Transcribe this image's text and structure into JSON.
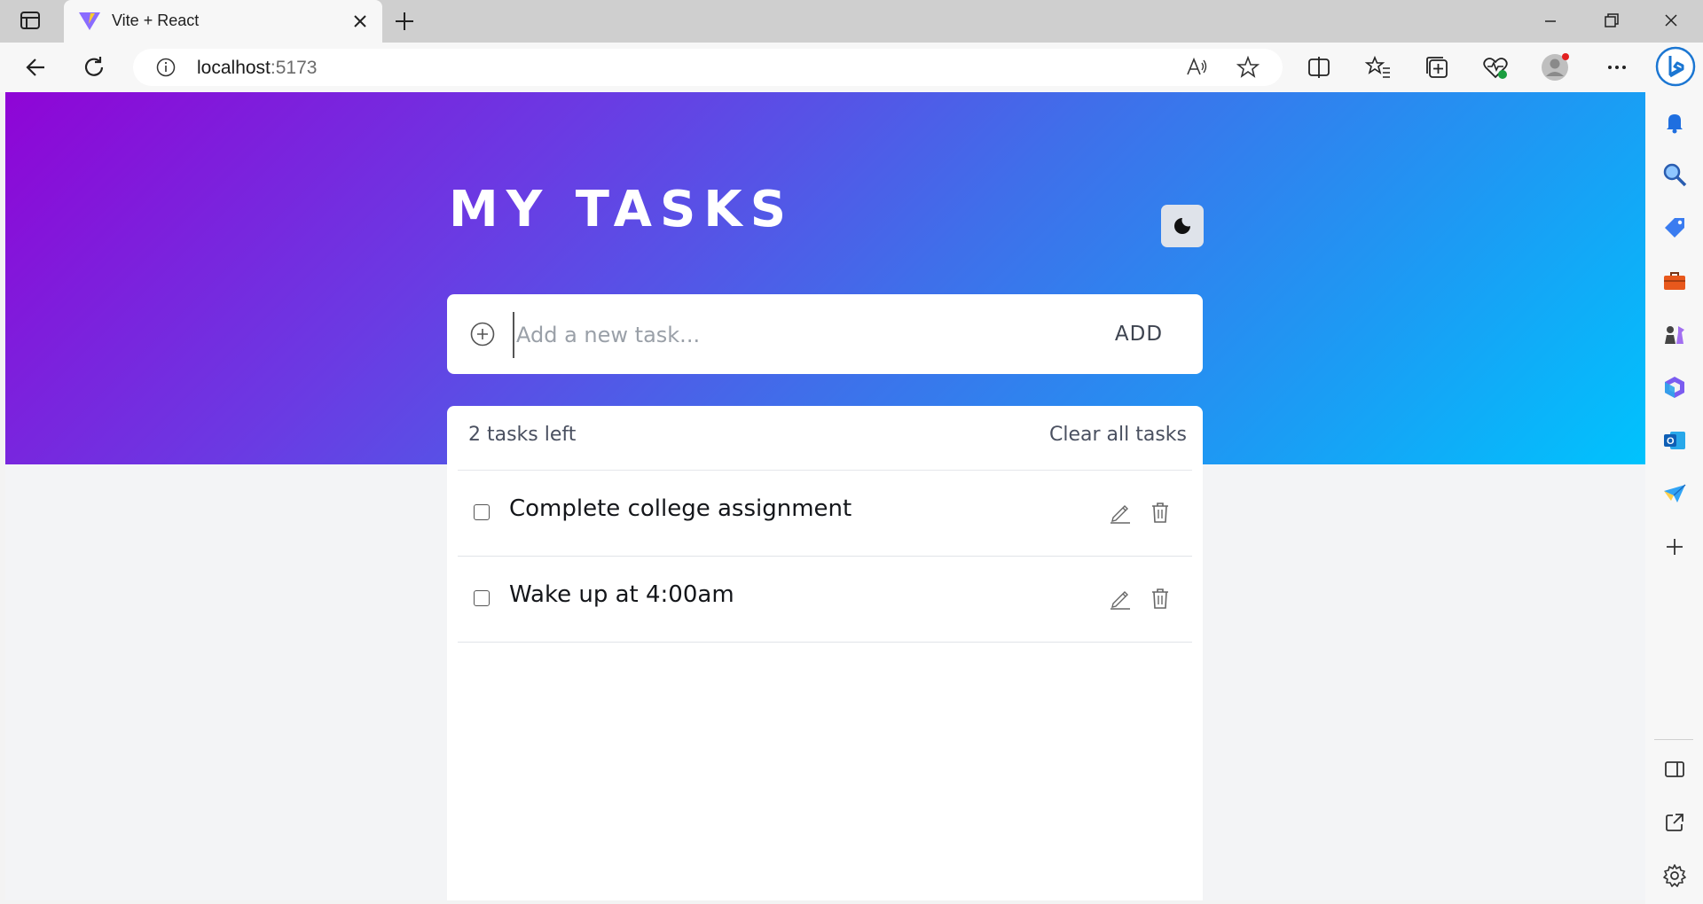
{
  "browser": {
    "tab_title": "Vite + React",
    "address_host": "localhost",
    "address_port": ":5173"
  },
  "app": {
    "title": "MY TASKS",
    "input_placeholder": "Add a new task...",
    "add_label": "ADD",
    "tasks_left": "2 tasks left",
    "clear_label": "Clear all tasks",
    "tasks": [
      {
        "text": "Complete college assignment",
        "done": false
      },
      {
        "text": "Wake up at 4:00am",
        "done": false
      }
    ]
  },
  "colors": {
    "gradient_start": "#8f05d6",
    "gradient_end": "#00c3fd",
    "card": "#ffffff"
  },
  "icons": {
    "theme_toggle": "moon-icon",
    "add": "plus-circle-icon",
    "edit": "pencil-icon",
    "delete": "trash-icon"
  }
}
